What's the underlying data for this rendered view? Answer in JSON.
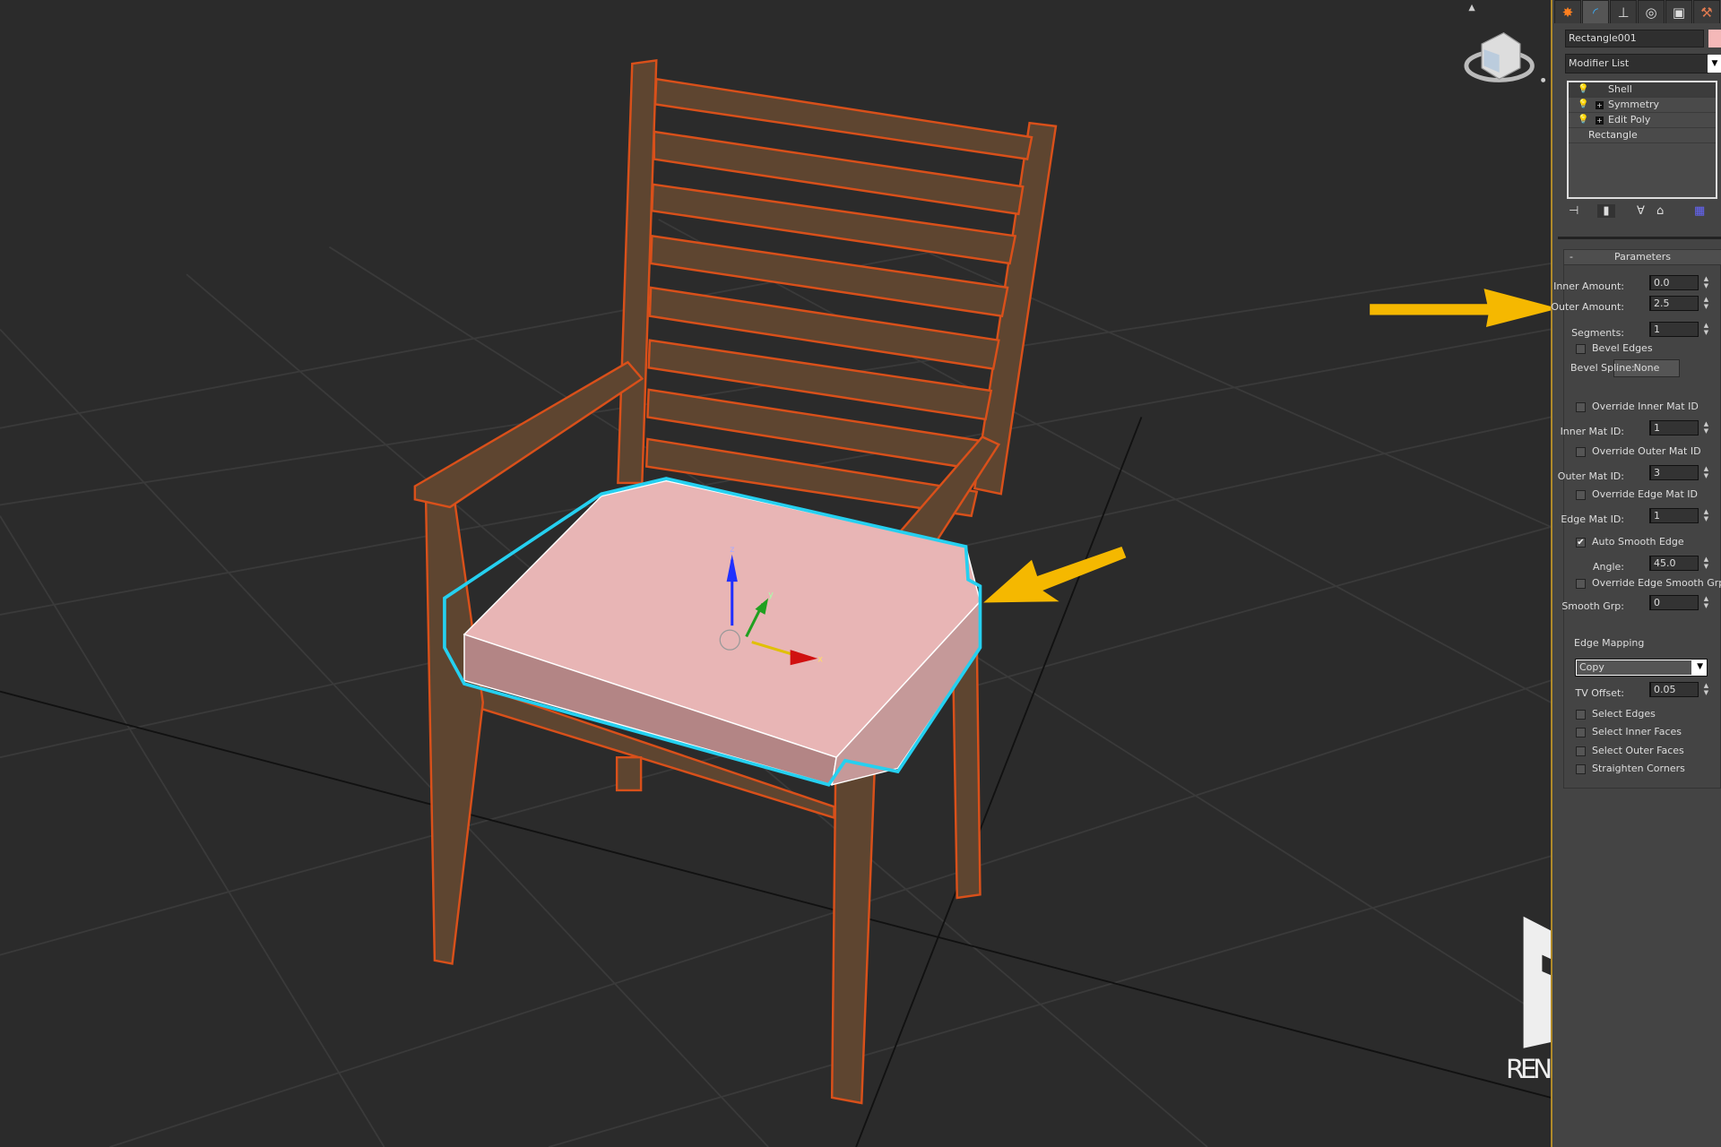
{
  "panel": {
    "tabs": [
      {
        "icon": "create-icon"
      },
      {
        "icon": "modify-icon",
        "active": true
      },
      {
        "icon": "hierarchy-icon"
      },
      {
        "icon": "motion-icon"
      },
      {
        "icon": "display-icon"
      },
      {
        "icon": "utilities-icon"
      }
    ],
    "object_name": "Rectangle001",
    "object_color": "#f4b8b8",
    "modifier_list": "Modifier List",
    "stack": [
      {
        "label": "Shell",
        "bulb": true,
        "plus": false
      },
      {
        "label": "Symmetry",
        "bulb": true,
        "plus": true
      },
      {
        "label": "Edit Poly",
        "bulb": true,
        "plus": true
      },
      {
        "label": "Rectangle",
        "bulb": false,
        "plus": false
      }
    ],
    "rollout_title": "Parameters",
    "rollout_toggle": "-",
    "inner_amount": {
      "label": "Inner Amount:",
      "value": "0.0"
    },
    "outer_amount": {
      "label": "Outer Amount:",
      "value": "2.5"
    },
    "segments": {
      "label": "Segments:",
      "value": "1"
    },
    "bevel_edges": {
      "label": "Bevel Edges",
      "checked": false
    },
    "bevel_spline": {
      "label": "Bevel Spline:",
      "value": "None"
    },
    "override_inner": {
      "label": "Override Inner Mat ID",
      "checked": false
    },
    "inner_mat_id": {
      "label": "Inner Mat ID:",
      "value": "1"
    },
    "override_outer": {
      "label": "Override Outer Mat ID",
      "checked": false
    },
    "outer_mat_id": {
      "label": "Outer Mat ID:",
      "value": "3"
    },
    "override_edge": {
      "label": "Override Edge Mat ID",
      "checked": false
    },
    "edge_mat_id": {
      "label": "Edge Mat ID:",
      "value": "1"
    },
    "auto_smooth": {
      "label": "Auto Smooth Edge",
      "checked": true
    },
    "angle": {
      "label": "Angle:",
      "value": "45.0"
    },
    "override_smooth": {
      "label": "Override Edge Smooth Grp",
      "checked": false
    },
    "smooth_grp": {
      "label": "Smooth Grp:",
      "value": "0"
    },
    "edge_mapping": {
      "label": "Edge Mapping",
      "value": "Copy"
    },
    "tv_offset": {
      "label": "TV Offset:",
      "value": "0.05"
    },
    "select_edges": {
      "label": "Select Edges",
      "checked": false
    },
    "select_inner": {
      "label": "Select Inner Faces",
      "checked": false
    },
    "select_outer": {
      "label": "Select Outer Faces",
      "checked": false
    },
    "straighten": {
      "label": "Straighten Corners",
      "checked": false
    }
  },
  "viewport": {
    "axis_labels": {
      "x": "x",
      "y": "y",
      "z": "z"
    },
    "annotation_color": "#f5b800",
    "selection_color": "#25d0f0"
  },
  "watermark": {
    "text": "RENDERNODE"
  }
}
